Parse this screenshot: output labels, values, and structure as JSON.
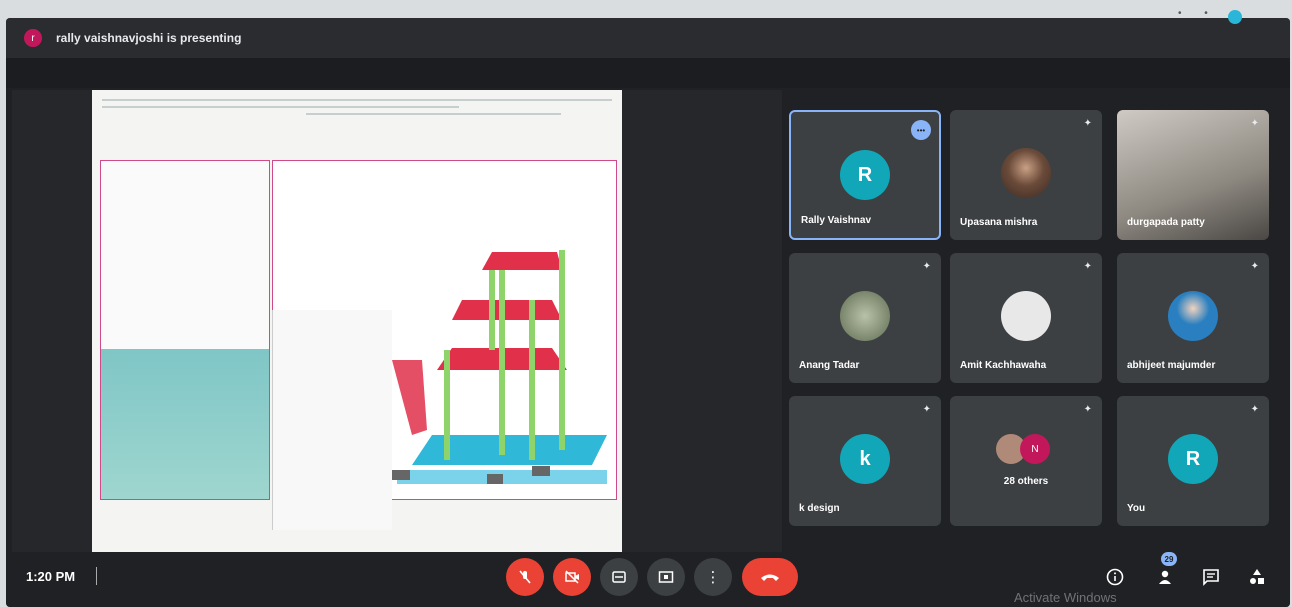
{
  "topbar": {
    "presenter_initial": "r",
    "presenter_text": "rally vaishnavjoshi is presenting"
  },
  "participants": [
    {
      "name": "Rally Vaishnav",
      "initial": "R",
      "avatar_color": "#12a7b8",
      "speaking": true,
      "speaking_label": "•••"
    },
    {
      "name": "Upasana mishra",
      "initial": "",
      "avatar_color": "#6b4b3a",
      "pinned_icon": "pin-icon"
    },
    {
      "name": "durgapada patty",
      "initial": "",
      "avatar_color": "#8a8580",
      "pinned_icon": "pin-icon"
    },
    {
      "name": "Anang Tadar",
      "initial": "",
      "avatar_color": "#7c8a6a",
      "pinned_icon": "pin-icon"
    },
    {
      "name": "Amit Kachhawaha",
      "initial": "",
      "avatar_color": "#e8e8e8",
      "pinned_icon": "pin-icon"
    },
    {
      "name": "abhijeet majumder",
      "initial": "",
      "avatar_color": "#2a7fc0",
      "pinned_icon": "pin-icon"
    },
    {
      "name": "k design",
      "initial": "k",
      "avatar_color": "#12a7b8",
      "pinned_icon": "pin-icon"
    },
    {
      "name": "",
      "initial": "",
      "avatar_color": "#c2185b",
      "pinned_icon": "pin-icon",
      "others_count": "28 others",
      "others_initial": "N"
    },
    {
      "name": "You",
      "initial": "R",
      "avatar_color": "#12a7b8",
      "pinned_icon": "pin-icon"
    }
  ],
  "controls": {
    "time": "1:20 PM",
    "mic_icon": "mic-off-icon",
    "camera_icon": "camera-off-icon",
    "captions_icon": "captions-icon",
    "present_icon": "present-screen-icon",
    "more_icon": "more-options-icon",
    "end_call_icon": "end-call-icon",
    "people_badge": "29"
  },
  "watermark": "Activate Windows",
  "colors": {
    "background": "#202124",
    "tile": "#3c4043",
    "red_button": "#ea4335",
    "accent": "#8ab4f8"
  }
}
